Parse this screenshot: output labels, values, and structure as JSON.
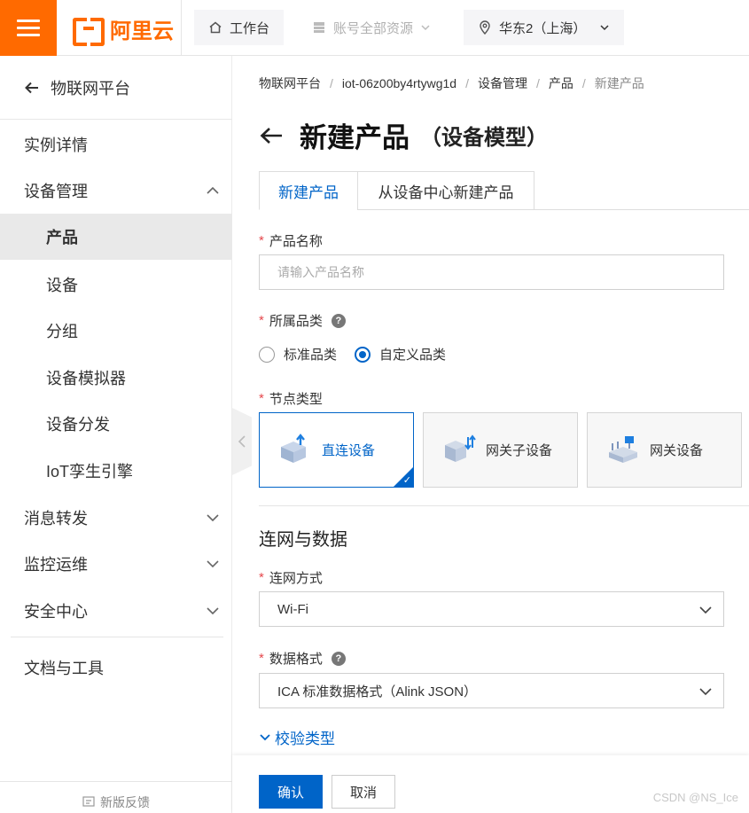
{
  "topbar": {
    "logo_text": "阿里云",
    "workbench": "工作台",
    "resources": "账号全部资源",
    "region": "华东2（上海）"
  },
  "sidebar": {
    "back_label": "物联网平台",
    "items": [
      {
        "label": "实例详情"
      },
      {
        "label": "设备管理"
      },
      {
        "label": "产品"
      },
      {
        "label": "设备"
      },
      {
        "label": "分组"
      },
      {
        "label": "设备模拟器"
      },
      {
        "label": "设备分发"
      },
      {
        "label": "IoT孪生引擎"
      },
      {
        "label": "消息转发"
      },
      {
        "label": "监控运维"
      },
      {
        "label": "安全中心"
      },
      {
        "label": "文档与工具"
      }
    ],
    "feedback": "新版反馈"
  },
  "breadcrumb": {
    "items": [
      "物联网平台",
      "iot-06z00by4rtywg1d",
      "设备管理",
      "产品",
      "新建产品"
    ]
  },
  "page": {
    "title": "新建产品",
    "subtitle": "（设备模型）"
  },
  "tabs": [
    "新建产品",
    "从设备中心新建产品"
  ],
  "form": {
    "product_name": {
      "label": "产品名称",
      "placeholder": "请输入产品名称",
      "value": ""
    },
    "category": {
      "label": "所属品类",
      "options": [
        "标准品类",
        "自定义品类"
      ],
      "selected": "自定义品类"
    },
    "node_type": {
      "label": "节点类型",
      "options": [
        "直连设备",
        "网关子设备",
        "网关设备"
      ],
      "selected": "直连设备"
    },
    "section_title": "连网与数据",
    "network": {
      "label": "连网方式",
      "value": "Wi-Fi"
    },
    "data_format": {
      "label": "数据格式",
      "value": "ICA 标准数据格式（Alink JSON）"
    },
    "expand_label": "校验类型"
  },
  "footer": {
    "confirm": "确认",
    "cancel": "取消",
    "watermark": "CSDN @NS_Ice"
  },
  "colors": {
    "brand": "#ff6a00",
    "primary": "#0064c8",
    "required": "#e5484d"
  }
}
